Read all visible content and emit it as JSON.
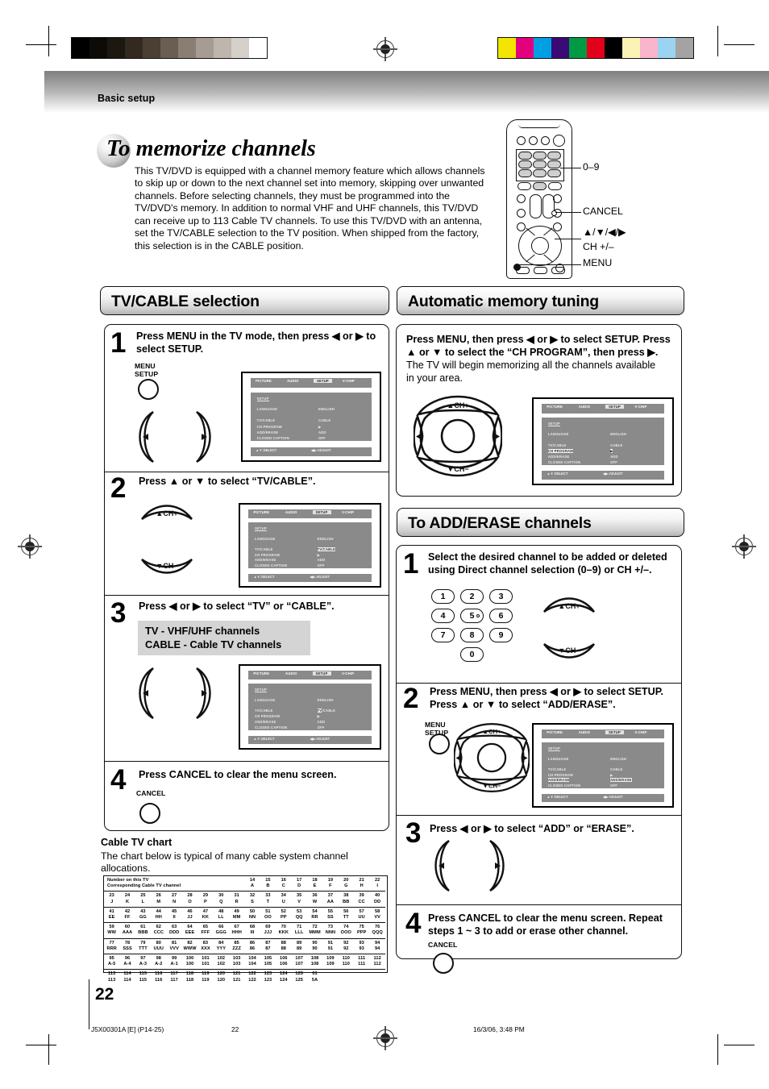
{
  "header": {
    "breadcrumb": "Basic setup"
  },
  "title": {
    "lead": "To",
    "rest": "memorize channels"
  },
  "intro": "This TV/DVD is equipped with a channel memory feature which allows channels to skip up or down to the next channel set into memory, skipping over unwanted channels. Before selecting channels, they must be programmed into the TV/DVD's memory. In addition to normal VHF and UHF channels, this TV/DVD can receive up to 113 Cable TV channels. To use this TV/DVD with an antenna, set the TV/CABLE selection to the TV position. When shipped from the factory, this selection is in the CABLE position.",
  "remote_callouts": {
    "keypad": "0–9",
    "cancel": "CANCEL",
    "arrows": "▲/▼/◀/▶",
    "ch": "CH +/–",
    "menu": "MENU"
  },
  "sections": {
    "tvcable": {
      "heading": "TV/CABLE selection",
      "steps": [
        {
          "num": "1",
          "text": "Press MENU in the TV mode, then press ◀ or ▶ to select SETUP.",
          "button_label": "MENU\nSETUP"
        },
        {
          "num": "2",
          "text": "Press ▲ or ▼ to select “TV/CABLE”."
        },
        {
          "num": "3",
          "text": "Press ◀ or ▶ to select “TV” or “CABLE”.",
          "note_line1": "TV - VHF/UHF channels",
          "note_line2": "CABLE - Cable TV channels"
        },
        {
          "num": "4",
          "text": "Press CANCEL to clear the menu screen.",
          "button_label": "CANCEL"
        }
      ]
    },
    "autotune": {
      "heading": "Automatic memory tuning",
      "step_bold1": "Press MENU, then press ◀ or ▶ to select SETUP. Press",
      "step_bold2": "▲ or ▼ to select the “CH PROGRAM”, then press ▶.",
      "step_norm": "The TV will begin memorizing all the channels available in your area."
    },
    "adderase": {
      "heading": "To ADD/ERASE channels",
      "steps": [
        {
          "num": "1",
          "text": "Select the desired channel to be added or deleted using Direct channel selection (0–9) or CH +/–."
        },
        {
          "num": "2",
          "text": "Press MENU, then press ◀ or ▶ to select SETUP. Press ▲ or ▼ to select “ADD/ERASE”.",
          "button_label": "MENU\nSETUP"
        },
        {
          "num": "3",
          "text": "Press ◀ or ▶ to select “ADD” or “ERASE”."
        },
        {
          "num": "4",
          "text": "Press CANCEL to clear the menu screen. Repeat steps 1 ~ 3 to add or erase other channel.",
          "button_label": "CANCEL"
        }
      ]
    }
  },
  "dpad_labels": {
    "up": "▲CH+",
    "down": "▼CH−"
  },
  "numpad": [
    "1",
    "2",
    "3",
    "4",
    "5",
    "6",
    "7",
    "8",
    "9",
    "0"
  ],
  "osd": {
    "tabs": [
      "PICTURE",
      "AUDIO",
      "SETUP",
      "V-CHIP"
    ],
    "selected_tab": "SETUP",
    "menu_title": "SETUP",
    "rows": [
      {
        "label": "LANGUAGE",
        "value": "ENGLISH"
      },
      {
        "label": "TV/CABLE",
        "value": "CABLE"
      },
      {
        "label": "CH PROGRAM",
        "value": "▶"
      },
      {
        "label": "ADD/ERASE",
        "value": "ADD"
      },
      {
        "label": "CLOSED CAPTION",
        "value": "OFF"
      }
    ],
    "footer_select": "▲▼:SELECT",
    "footer_adjust": "◀▶:ADJUST",
    "variants": {
      "step1_tvcable_value": "CABLE",
      "step2_tvcable_value": "TV/CABLE",
      "step3_tvcable_value": "TV/CABLE",
      "adderase_value": "ADD/ERASE"
    }
  },
  "cable_chart": {
    "title": "Cable TV chart",
    "subtitle": "The chart below is typical of many cable system channel allocations.",
    "row_label_line1": "Number on this TV",
    "row_label_line2": "Corresponding Cable TV channel",
    "rows": [
      {
        "tv": [
          "",
          "",
          "",
          "",
          "",
          "",
          "",
          "",
          "",
          "14",
          "15",
          "16",
          "17",
          "18",
          "19",
          "20",
          "21",
          "22"
        ],
        "cable": [
          "",
          "",
          "",
          "",
          "",
          "",
          "",
          "",
          "",
          "A",
          "B",
          "C",
          "D",
          "E",
          "F",
          "G",
          "H",
          "I"
        ]
      },
      {
        "tv": [
          "23",
          "24",
          "25",
          "26",
          "27",
          "28",
          "29",
          "30",
          "31",
          "32",
          "33",
          "34",
          "35",
          "36",
          "37",
          "38",
          "39",
          "40"
        ],
        "cable": [
          "J",
          "K",
          "L",
          "M",
          "N",
          "O",
          "P",
          "Q",
          "R",
          "S",
          "T",
          "U",
          "V",
          "W",
          "AA",
          "BB",
          "CC",
          "DD"
        ]
      },
      {
        "tv": [
          "41",
          "42",
          "43",
          "44",
          "45",
          "46",
          "47",
          "48",
          "49",
          "50",
          "51",
          "52",
          "53",
          "54",
          "55",
          "56",
          "57",
          "58"
        ],
        "cable": [
          "EE",
          "FF",
          "GG",
          "HH",
          "II",
          "JJ",
          "KK",
          "LL",
          "MM",
          "NN",
          "OO",
          "PP",
          "QQ",
          "RR",
          "SS",
          "TT",
          "UU",
          "VV"
        ]
      },
      {
        "tv": [
          "59",
          "60",
          "61",
          "62",
          "63",
          "64",
          "65",
          "66",
          "67",
          "68",
          "69",
          "70",
          "71",
          "72",
          "73",
          "74",
          "75",
          "76"
        ],
        "cable": [
          "WW",
          "AAA",
          "BBB",
          "CCC",
          "DDD",
          "EEE",
          "FFF",
          "GGG",
          "HHH",
          "III",
          "JJJ",
          "KKK",
          "LLL",
          "MMM",
          "NNN",
          "OOO",
          "PPP",
          "QQQ"
        ]
      },
      {
        "tv": [
          "77",
          "78",
          "79",
          "80",
          "81",
          "82",
          "83",
          "84",
          "85",
          "86",
          "87",
          "88",
          "89",
          "90",
          "91",
          "92",
          "93",
          "94"
        ],
        "cable": [
          "RRR",
          "SSS",
          "TTT",
          "UUU",
          "VVV",
          "WWW",
          "XXX",
          "YYY",
          "ZZZ",
          "86",
          "87",
          "88",
          "89",
          "90",
          "91",
          "92",
          "93",
          "94"
        ]
      },
      {
        "tv": [
          "95",
          "96",
          "97",
          "98",
          "99",
          "100",
          "101",
          "102",
          "103",
          "104",
          "105",
          "106",
          "107",
          "108",
          "109",
          "110",
          "111",
          "112"
        ],
        "cable": [
          "A-5",
          "A-4",
          "A-3",
          "A-2",
          "A-1",
          "100",
          "101",
          "102",
          "103",
          "104",
          "105",
          "106",
          "107",
          "108",
          "109",
          "110",
          "111",
          "112"
        ]
      },
      {
        "tv": [
          "113",
          "114",
          "115",
          "116",
          "117",
          "118",
          "119",
          "120",
          "121",
          "122",
          "123",
          "124",
          "125",
          "01",
          "",
          "",
          "",
          ""
        ],
        "cable": [
          "113",
          "114",
          "115",
          "116",
          "117",
          "118",
          "119",
          "120",
          "121",
          "122",
          "123",
          "124",
          "125",
          "5A",
          "",
          "",
          "",
          ""
        ]
      }
    ]
  },
  "footer": {
    "page_number": "22",
    "doc_id": "J5X00301A [E] (P14-25)",
    "doc_page": "22",
    "timestamp": "16/3/06, 3:48 PM"
  },
  "colors": {
    "grey_ramp": [
      "#000000",
      "#0d0a08",
      "#1d1712",
      "#33291f",
      "#4b3f34",
      "#6a5d52",
      "#8a7e74",
      "#a79c93",
      "#beb5ad",
      "#d6d0ca",
      "#ffffff"
    ],
    "color_bars": [
      "#f2e500",
      "#e2007f",
      "#009fe3",
      "#3a0a77",
      "#009a44",
      "#e2001a",
      "#000000",
      "#fbf3b6",
      "#f9b5cb",
      "#9bd3f3",
      "#a3a3a3"
    ]
  }
}
